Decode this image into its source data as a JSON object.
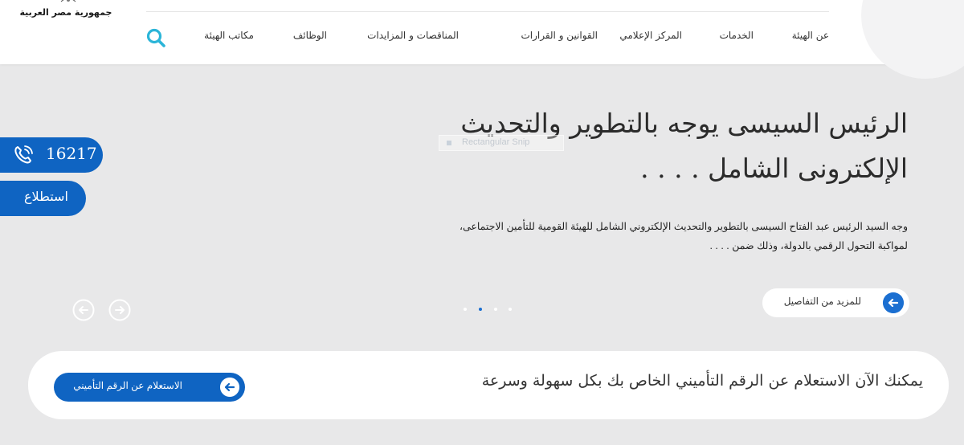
{
  "logo": {
    "text": "جمهورية مصر العربية"
  },
  "nav": {
    "items": [
      {
        "label": "عن الهيئة"
      },
      {
        "label": "الخدمات"
      },
      {
        "label": "المركز الإعلامي"
      },
      {
        "label": "القوانين و القرارات"
      },
      {
        "label": "المناقصات و المزايدات"
      },
      {
        "label": "الوظائف"
      },
      {
        "label": "مكاتب الهيئة"
      }
    ],
    "search_icon": "search-icon"
  },
  "hero": {
    "title_line1": "الرئيس السيسى يوجه بالتطوير والتحديث",
    "title_line2": "الإلكترونى الشامل . . . .",
    "desc_line1": "وجه السيد الرئيس عبد الفتاح السيسى بالتطوير والتحديث الإلكتروني الشامل للهيئة القومية للتأمين الاجتماعى،",
    "desc_line2": "لمواكبة التحول الرقمي بالدولة، وذلك ضمن . . . .",
    "more_label": "للمزيد من التفاصيل",
    "slide_count": 4,
    "active_slide": 2
  },
  "overlay": {
    "snip_label": "Rectangular Snip"
  },
  "side": {
    "phone_number": "16217",
    "poll_label": "استطلاع"
  },
  "inquiry": {
    "text": "يمكنك الآن الاستعلام عن الرقم التأميني الخاص بك بكل سهولة وسرعة",
    "button_label": "الاستعلام عن الرقم التأميني"
  },
  "colors": {
    "primary": "#0f64c2",
    "accent": "#1b6fd1",
    "search": "#2bb5d8",
    "background": "#e8e8e9"
  }
}
